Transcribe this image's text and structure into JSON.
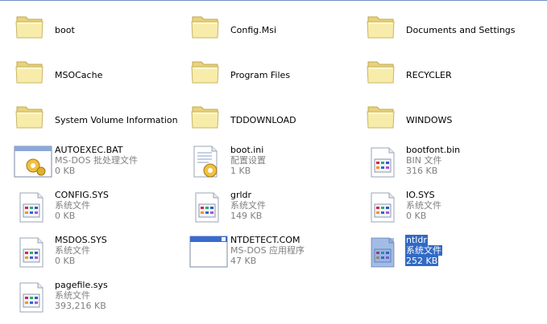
{
  "colors": {
    "selection": "#316ac5",
    "folder": "#f5e79e",
    "folder_outline": "#c8b466"
  },
  "folders": [
    {
      "name": "boot",
      "icon": "folder-icon"
    },
    {
      "name": "Config.Msi",
      "icon": "folder-icon"
    },
    {
      "name": "Documents and Settings",
      "icon": "folder-icon"
    },
    {
      "name": "MSOCache",
      "icon": "folder-icon"
    },
    {
      "name": "Program Files",
      "icon": "folder-icon"
    },
    {
      "name": "RECYCLER",
      "icon": "folder-icon"
    },
    {
      "name": "System Volume Information",
      "icon": "folder-icon"
    },
    {
      "name": "TDDOWNLOAD",
      "icon": "folder-icon"
    },
    {
      "name": "WINDOWS",
      "icon": "folder-icon"
    }
  ],
  "files": [
    {
      "name": "AUTOEXEC.BAT",
      "type": "MS-DOS 批处理文件",
      "size": "0 KB",
      "icon": "batch-file-icon"
    },
    {
      "name": "boot.ini",
      "type": "配置设置",
      "size": "1 KB",
      "icon": "config-settings-icon"
    },
    {
      "name": "bootfont.bin",
      "type": "BIN 文件",
      "size": "316 KB",
      "icon": "system-file-icon"
    },
    {
      "name": "CONFIG.SYS",
      "type": "系统文件",
      "size": "0 KB",
      "icon": "system-file-icon"
    },
    {
      "name": "grldr",
      "type": "系统文件",
      "size": "149 KB",
      "icon": "system-file-icon"
    },
    {
      "name": "IO.SYS",
      "type": "系统文件",
      "size": "0 KB",
      "icon": "system-file-icon"
    },
    {
      "name": "MSDOS.SYS",
      "type": "系统文件",
      "size": "0 KB",
      "icon": "system-file-icon"
    },
    {
      "name": "NTDETECT.COM",
      "type": "MS-DOS 应用程序",
      "size": "47 KB",
      "icon": "application-icon"
    },
    {
      "name": "ntldr",
      "type": "系统文件",
      "size": "252 KB",
      "icon": "system-file-icon",
      "selected": true
    },
    {
      "name": "pagefile.sys",
      "type": "系统文件",
      "size": "393,216 KB",
      "icon": "system-file-icon"
    }
  ]
}
